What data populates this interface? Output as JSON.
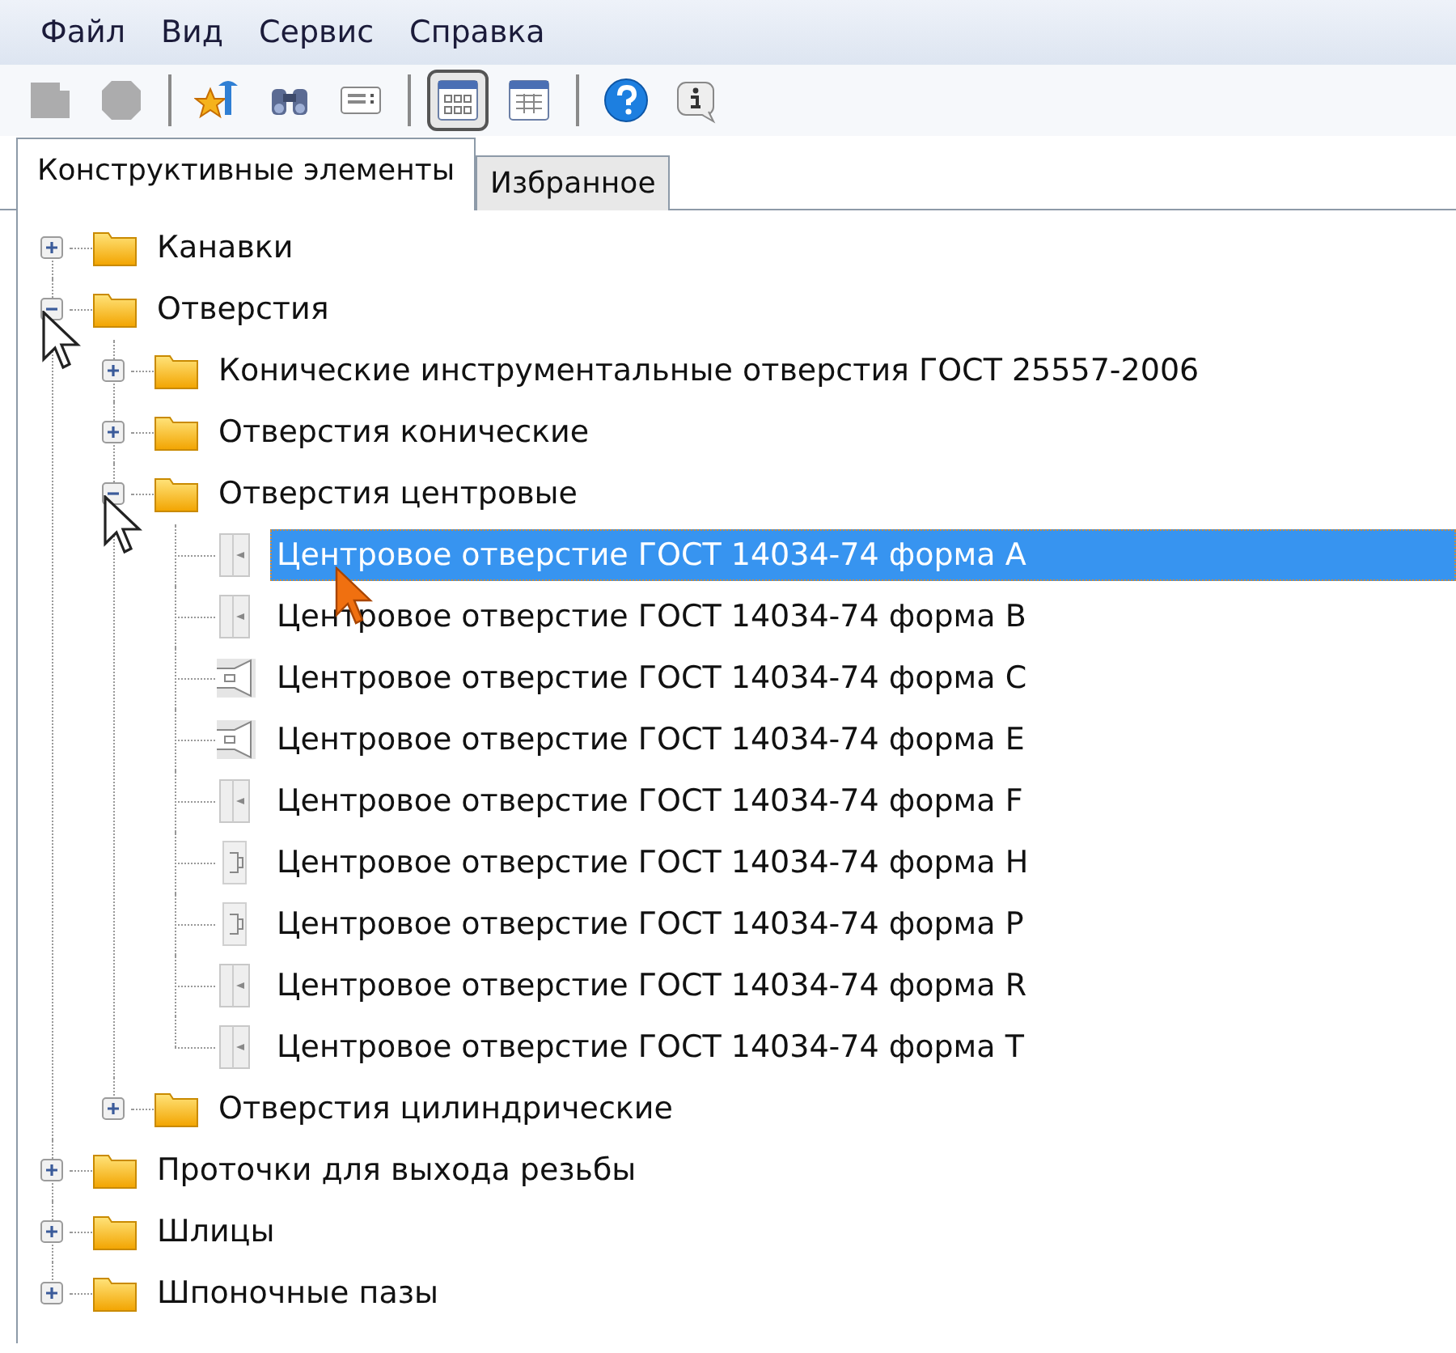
{
  "menu": [
    "Файл",
    "Вид",
    "Сервис",
    "Справка"
  ],
  "toolbar": [
    {
      "kind": "square",
      "disabled": true,
      "pressed": false
    },
    {
      "kind": "octagon",
      "disabled": true,
      "pressed": false
    },
    {
      "kind": "separator"
    },
    {
      "kind": "star",
      "disabled": false,
      "pressed": false
    },
    {
      "kind": "binoculars",
      "disabled": false,
      "pressed": false
    },
    {
      "kind": "list",
      "disabled": false,
      "pressed": false
    },
    {
      "kind": "separator"
    },
    {
      "kind": "grid",
      "disabled": false,
      "pressed": true
    },
    {
      "kind": "table",
      "disabled": false,
      "pressed": false
    },
    {
      "kind": "separator"
    },
    {
      "kind": "help",
      "disabled": false,
      "pressed": false
    },
    {
      "kind": "info",
      "disabled": false,
      "pressed": false
    }
  ],
  "tabs": [
    {
      "label": "Конструктивные элементы",
      "selected": true
    },
    {
      "label": "Избранное",
      "selected": false
    }
  ],
  "tree": [
    {
      "label": "Канавки",
      "kind": "folder",
      "expanded": false,
      "selected": false,
      "pointer": false
    },
    {
      "label": "Отверстия",
      "kind": "folder",
      "expanded": true,
      "selected": false,
      "pointer": true,
      "children": [
        {
          "label": "Конические инструментальные отверстия ГОСТ 25557-2006",
          "kind": "folder",
          "expanded": false,
          "selected": false,
          "pointer": false
        },
        {
          "label": "Отверстия конические",
          "kind": "folder",
          "expanded": false,
          "selected": false,
          "pointer": false
        },
        {
          "label": "Отверстия центровые",
          "kind": "folder",
          "expanded": true,
          "selected": false,
          "pointer": true,
          "children": [
            {
              "label": "Центровое отверстие ГОСТ 14034-74 форма A",
              "kind": "plain",
              "selected": true,
              "pointer": true
            },
            {
              "label": "Центровое отверстие ГОСТ 14034-74 форма B",
              "kind": "plain",
              "selected": false,
              "pointer": false
            },
            {
              "label": "Центровое отверстие ГОСТ 14034-74 форма C",
              "kind": "cone",
              "selected": false,
              "pointer": false
            },
            {
              "label": "Центровое отверстие ГОСТ 14034-74 форма E",
              "kind": "cone",
              "selected": false,
              "pointer": false
            },
            {
              "label": "Центровое отверстие ГОСТ 14034-74 форма F",
              "kind": "plain",
              "selected": false,
              "pointer": false
            },
            {
              "label": "Центровое отверстие ГОСТ 14034-74 форма H",
              "kind": "stepped",
              "selected": false,
              "pointer": false
            },
            {
              "label": "Центровое отверстие ГОСТ 14034-74 форма P",
              "kind": "stepped",
              "selected": false,
              "pointer": false
            },
            {
              "label": "Центровое отверстие ГОСТ 14034-74 форма R",
              "kind": "plain",
              "selected": false,
              "pointer": false
            },
            {
              "label": "Центровое отверстие ГОСТ 14034-74 форма T",
              "kind": "plain",
              "selected": false,
              "pointer": false
            }
          ]
        },
        {
          "label": "Отверстия цилиндрические",
          "kind": "folder",
          "expanded": false,
          "selected": false,
          "pointer": false
        }
      ]
    },
    {
      "label": "Проточки для выхода резьбы",
      "kind": "folder",
      "expanded": false,
      "selected": false,
      "pointer": false
    },
    {
      "label": "Шлицы",
      "kind": "folder",
      "expanded": false,
      "selected": false,
      "pointer": false
    },
    {
      "label": "Шпоночные пазы",
      "kind": "folder",
      "expanded": false,
      "selected": false,
      "pointer": false
    }
  ]
}
